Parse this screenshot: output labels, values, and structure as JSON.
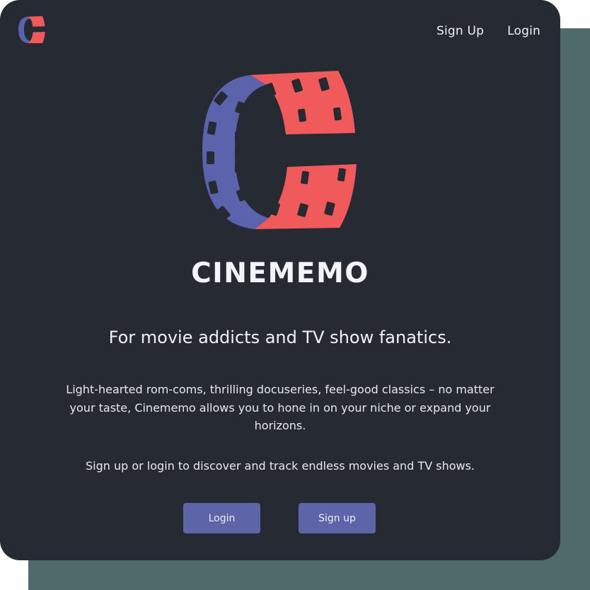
{
  "nav": {
    "signup_label": "Sign Up",
    "login_label": "Login"
  },
  "brand": {
    "title": "CINEMEMO"
  },
  "hero": {
    "tagline": "For movie addicts and TV show fanatics.",
    "description": "Light-hearted rom-coms, thrilling docuseries, feel-good classics – no matter your taste, Cinememo allows you to hone in on your niche or expand your horizons.",
    "cta_text": "Sign up or login to discover and track endless movies and TV shows."
  },
  "buttons": {
    "login_label": "Login",
    "signup_label": "Sign up"
  },
  "icons": {
    "nav_logo": "film-reel-logo-icon",
    "hero_logo": "film-reel-logo-icon"
  },
  "colors": {
    "background": "#262a33",
    "backdrop": "#4f6b69",
    "brand_blue": "#5b63ad",
    "brand_red": "#f05a5a",
    "button": "#5e64a8",
    "text": "#f1f2f5"
  }
}
